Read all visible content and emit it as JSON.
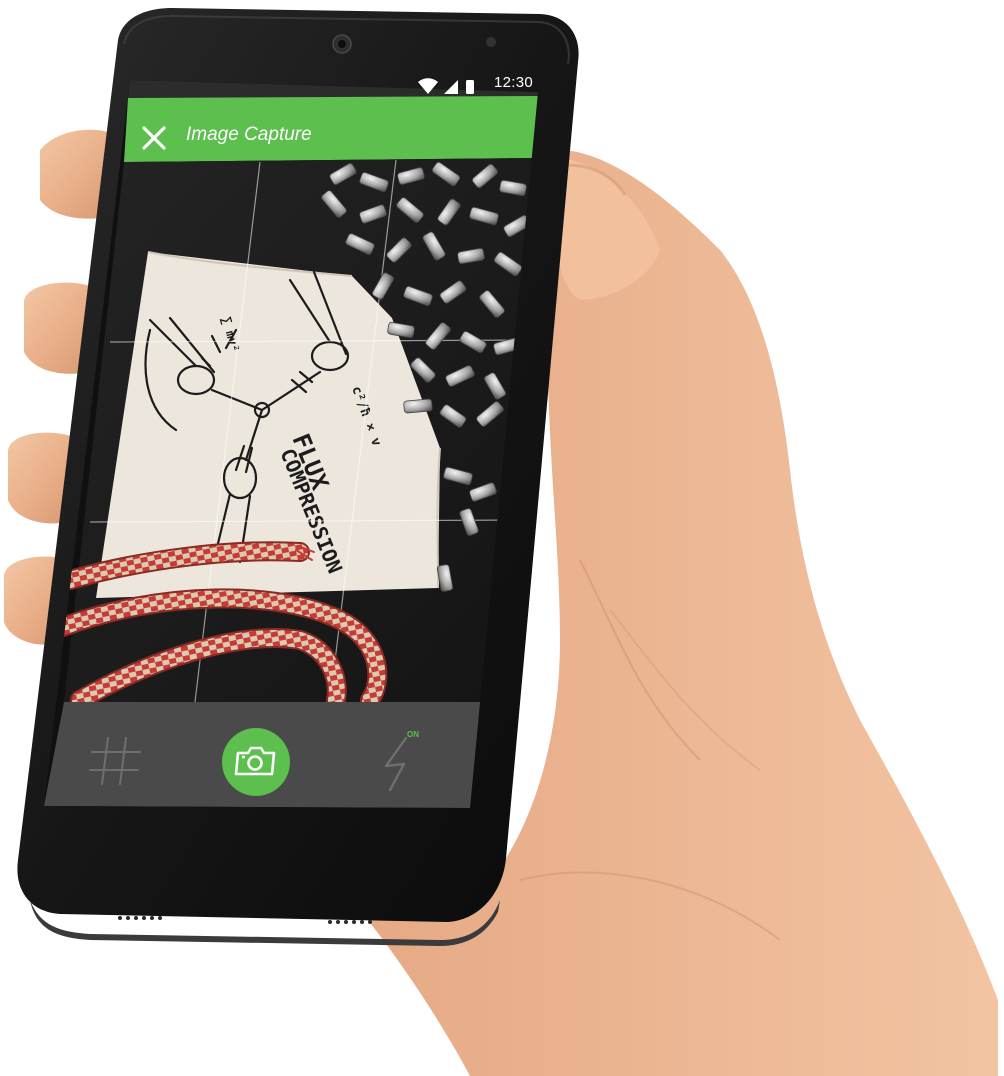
{
  "status_bar": {
    "time": "12:30",
    "icons": [
      "wifi-icon",
      "cellular-signal-icon",
      "battery-icon"
    ]
  },
  "app_bar": {
    "title": "Image Capture",
    "close_icon": "close-icon",
    "color": "#5cbf4e"
  },
  "viewfinder": {
    "gridlines": true,
    "sketch_text": [
      "FLUX",
      "COMPRESSION"
    ]
  },
  "controls": {
    "grid_icon": "grid-hash-icon",
    "shutter_icon": "camera-icon",
    "flash_icon": "flash-icon",
    "flash_state": "ON",
    "accent_color": "#5cbf4e",
    "bar_color": "#4a4a4a"
  }
}
